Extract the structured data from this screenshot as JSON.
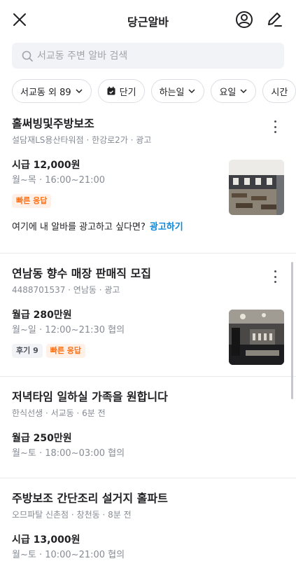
{
  "header": {
    "title": "당근알바",
    "close_icon": "close-icon",
    "profile_icon": "profile-icon",
    "write_icon": "pencil-icon"
  },
  "search": {
    "placeholder": "서교동 주변 알바 검색",
    "icon": "search-icon"
  },
  "filters": [
    {
      "label": "서교동 외 89",
      "has_chevron": true
    },
    {
      "label": "단기",
      "icon": "calendar-icon"
    },
    {
      "label": "하는일",
      "has_chevron": true
    },
    {
      "label": "요일",
      "has_chevron": true
    },
    {
      "label": "시간"
    }
  ],
  "jobs": [
    {
      "title": "홀써빙및주방보조",
      "meta": "설담재LS용산타워점 · 한강로2가 · 광고",
      "pay": "시급 12,000원",
      "schedule": "월~목 · 16:00~21:00",
      "badges": [
        "빠른 응답"
      ],
      "ad_note": "여기에 내 알바를 광고하고 싶다면?",
      "ad_link": "광고하기"
    },
    {
      "title": "연남동 향수 매장 판매직 모집",
      "meta": "4488701537 · 연남동 · 광고",
      "pay": "월급 280만원",
      "schedule": "월~일 · 12:00~21:30 협의",
      "badges": [
        "후기 9",
        "빠른 응답"
      ]
    },
    {
      "title": "저녁타임 일하실 가족을 원합니다",
      "meta": "한식선생 · 서교동 · 6분 전",
      "pay": "월급 250만원",
      "schedule": "월~토 · 18:00~03:00 협의"
    },
    {
      "title": "주방보조 간단조리 설거지 홀파트",
      "meta": "오므파탈 신촌점 · 창천동 · 8분 전",
      "pay": "시급 13,000원",
      "schedule": "월~토 · 10:00~21:00 협의"
    }
  ],
  "colors": {
    "accent_orange": "#ff6f0f",
    "link_blue": "#0a87d8",
    "text_primary": "#212124",
    "text_secondary": "#868b94"
  }
}
